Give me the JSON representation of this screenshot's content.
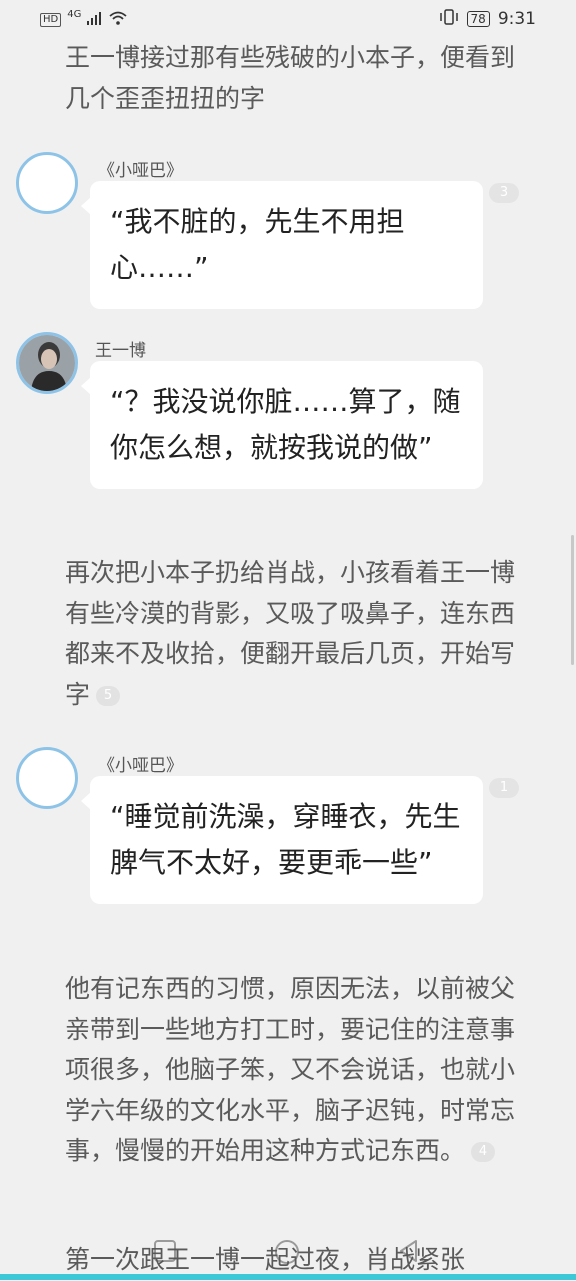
{
  "status_bar": {
    "hd": "HD",
    "network": "4G",
    "battery": "78",
    "time": "9:31"
  },
  "story": {
    "para1": "王一博接过那有些残破的小本子，便看到几个歪歪扭扭的字",
    "msg1": {
      "speaker": "《小哑巴》",
      "text": "“我不脏的，先生不用担心……”",
      "badge": "3"
    },
    "msg2": {
      "speaker": "王一博",
      "text": "“？我没说你脏……算了，随你怎么想，就按我说的做”"
    },
    "para2": {
      "text": "再次把小本子扔给肖战，小孩看着王一博有些冷漠的背影，又吸了吸鼻子，连东西都来不及收拾，便翻开最后几页，开始写字",
      "badge": "5"
    },
    "msg3": {
      "speaker": "《小哑巴》",
      "text": "“睡觉前洗澡，穿睡衣，先生脾气不太好，要更乖一些”",
      "badge": "1"
    },
    "para3": {
      "text": "他有记东西的习惯，原因无法，以前被父亲带到一些地方打工时，要记住的注意事项很多，他脑子笨，又不会说话，也就小学六年级的文化水平，脑子迟钝，时常忘事，慢慢的开始用这种方式记东西。",
      "badge": "4"
    },
    "para4": "第一次跟王一博一起过夜，肖战紧张"
  },
  "icons": {
    "signal": "signal-icon",
    "wifi": "wifi-icon",
    "vibrate": "vibrate-icon",
    "nav_recent": "square-icon",
    "nav_home": "circle-icon",
    "nav_back": "triangle-back-icon"
  },
  "colors": {
    "avatar_ring": "#8ec3e8",
    "accent_bar": "#3cc8d6",
    "background": "#f0f0f0"
  }
}
